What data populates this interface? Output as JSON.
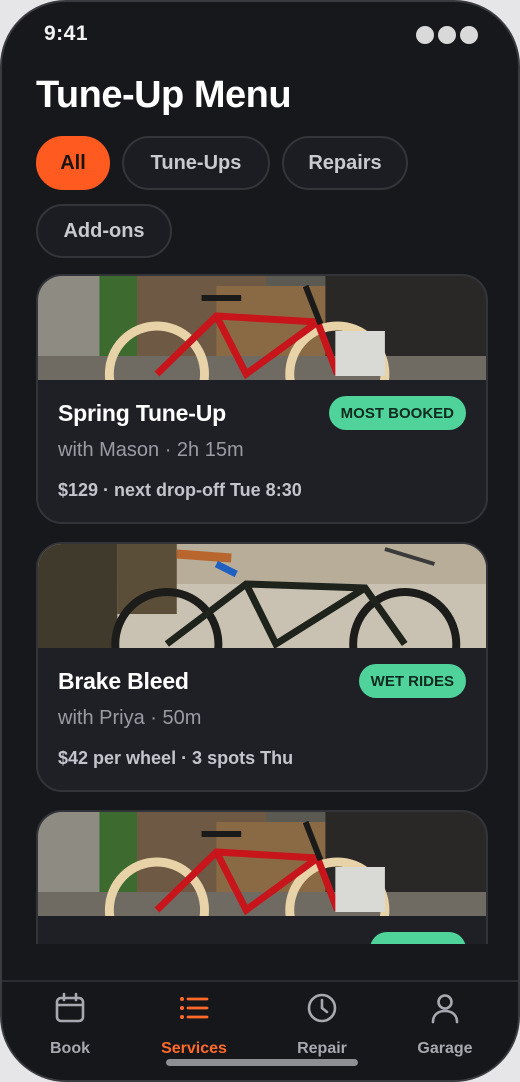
{
  "status": {
    "time": "9:41"
  },
  "header": {
    "title": "Tune-Up Menu"
  },
  "filters": [
    {
      "label": "All",
      "active": true
    },
    {
      "label": "Tune-Ups",
      "active": false
    },
    {
      "label": "Repairs",
      "active": false
    },
    {
      "label": "Add-ons",
      "active": false
    }
  ],
  "services": [
    {
      "name": "Spring Tune-Up",
      "badge": "MOST BOOKED",
      "mechanic": "with Mason · 2h 15m",
      "price_note": "$129 · next drop-off Tue 8:30",
      "photo": "red-cruiser-bicycle"
    },
    {
      "name": "Brake Bleed",
      "badge": "WET RIDES",
      "mechanic": "with Priya · 50m",
      "price_note": "$42 per wheel · 3 spots Thu",
      "photo": "black-city-bicycle"
    },
    {
      "name": "",
      "badge": "",
      "mechanic": "",
      "price_note": "",
      "photo": "red-cruiser-bicycle"
    }
  ],
  "tabs": [
    {
      "label": "Book",
      "icon": "calendar-icon",
      "active": false
    },
    {
      "label": "Services",
      "icon": "list-icon",
      "active": true
    },
    {
      "label": "Repair",
      "icon": "clock-icon",
      "active": false
    },
    {
      "label": "Garage",
      "icon": "person-icon",
      "active": false
    }
  ],
  "colors": {
    "accent": "#ff5a1f",
    "badge": "#4fd39a",
    "background": "#17181c"
  }
}
